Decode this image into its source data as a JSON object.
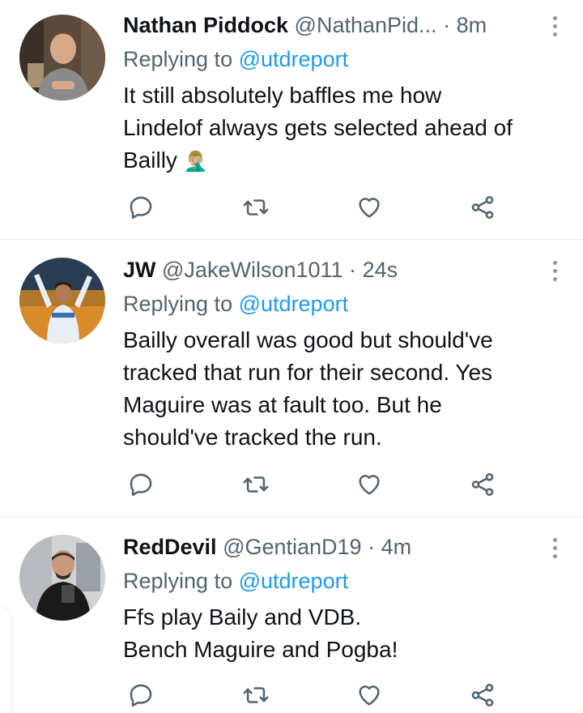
{
  "tweets": [
    {
      "name": "Nathan Piddock",
      "handle": "@NathanPid...",
      "separator": "·",
      "time": "8m",
      "replying_prefix": "Replying to",
      "replying_to": "@utdreport",
      "lines": [
        "It still absolutely baffles me how",
        "Lindelof always gets selected ahead of",
        "Bailly"
      ],
      "emoji": "🤦🏼‍♂️"
    },
    {
      "name": "JW",
      "handle": "@JakeWilson1011",
      "separator": "·",
      "time": "24s",
      "replying_prefix": "Replying to",
      "replying_to": "@utdreport",
      "lines": [
        "Bailly overall was good but should've",
        "tracked that run for their second. Yes",
        "Maguire was at fault too. But he",
        "should've tracked the run."
      ]
    },
    {
      "name": "RedDevil",
      "handle": "@GentianD19",
      "separator": "·",
      "time": "4m",
      "replying_prefix": "Replying to",
      "replying_to": "@utdreport",
      "lines": [
        "Ffs play Baily and VDB.",
        "Bench Maguire and Pogba!"
      ]
    }
  ],
  "icons": {
    "reply": "reply-icon",
    "retweet": "retweet-icon",
    "like": "heart-icon",
    "share": "share-icon",
    "more": "more-icon"
  },
  "colors": {
    "link": "#1d9bf0",
    "secondary_text": "#536471",
    "primary_text": "#0f1419",
    "icon": "#536471",
    "divider": "#e6e9ec"
  }
}
